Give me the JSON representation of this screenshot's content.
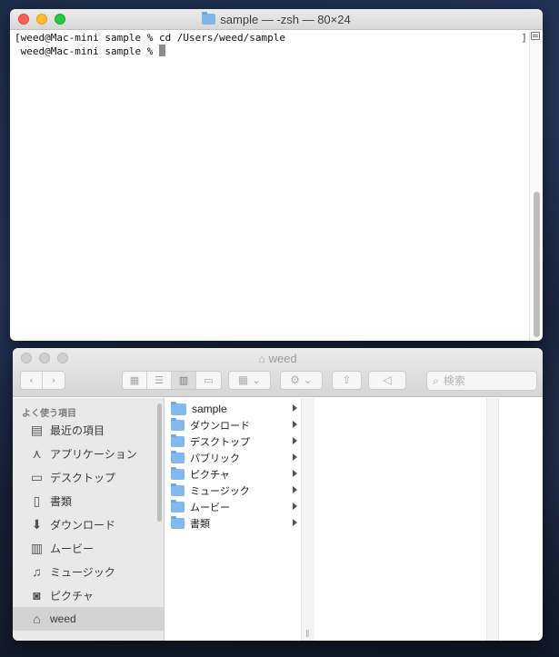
{
  "terminal": {
    "title": "sample — -zsh — 80×24",
    "lines": [
      "[weed@Mac-mini sample % cd /Users/weed/sample",
      " weed@Mac-mini sample % "
    ],
    "right_bracket": "]"
  },
  "finder": {
    "title": "weed",
    "search_placeholder": "検索",
    "sidebar_heading": "よく使う項目",
    "sidebar_items": [
      {
        "label": "最近の項目",
        "icon": "recents-icon"
      },
      {
        "label": "アプリケーション",
        "icon": "applications-icon"
      },
      {
        "label": "デスクトップ",
        "icon": "desktop-icon"
      },
      {
        "label": "書類",
        "icon": "documents-icon"
      },
      {
        "label": "ダウンロード",
        "icon": "downloads-icon"
      },
      {
        "label": "ムービー",
        "icon": "movies-icon"
      },
      {
        "label": "ミュージック",
        "icon": "music-icon"
      },
      {
        "label": "ピクチャ",
        "icon": "pictures-icon"
      },
      {
        "label": "weed",
        "icon": "home-icon",
        "selected": true
      }
    ],
    "column_items": [
      "sample",
      "ダウンロード",
      "デスクトップ",
      "パブリック",
      "ピクチャ",
      "ミュージック",
      "ムービー",
      "書類"
    ]
  }
}
